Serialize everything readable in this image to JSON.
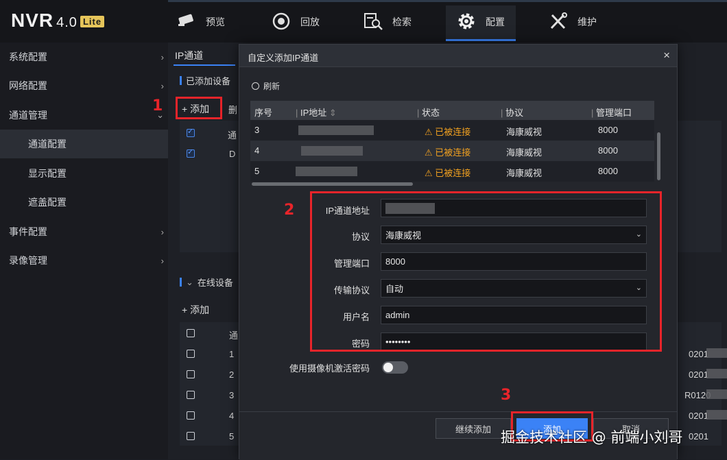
{
  "app": {
    "brand": "NVR",
    "version": "4.0",
    "edition": "Lite"
  },
  "nav": [
    {
      "label": "预览",
      "icon": "camera-icon"
    },
    {
      "label": "回放",
      "icon": "playback-icon"
    },
    {
      "label": "检索",
      "icon": "search-file-icon"
    },
    {
      "label": "配置",
      "icon": "gear-icon",
      "active": true
    },
    {
      "label": "维护",
      "icon": "tools-icon"
    }
  ],
  "sidebar": {
    "items": [
      {
        "label": "系统配置",
        "chevron": "›"
      },
      {
        "label": "网络配置",
        "chevron": "›"
      },
      {
        "label": "通道管理",
        "chevron": "⌄"
      },
      {
        "label": "通道配置"
      },
      {
        "label": "显示配置"
      },
      {
        "label": "遮盖配置"
      },
      {
        "label": "事件配置",
        "chevron": "›"
      },
      {
        "label": "录像管理",
        "chevron": "›"
      }
    ]
  },
  "main": {
    "tab": "IP通道",
    "added_section": "已添加设备",
    "add_label": "+ 添加",
    "del_label": "删",
    "added_rows": [
      {
        "col": "通"
      },
      {
        "col": "D"
      }
    ],
    "online_section": "在线设备",
    "online_add": "+ 添加",
    "online_header": "通",
    "online_rows": [
      {
        "no": "1",
        "serial": "0201"
      },
      {
        "no": "2",
        "serial": "0201"
      },
      {
        "no": "3",
        "serial": "R0120"
      },
      {
        "no": "4",
        "serial": "0201"
      },
      {
        "no": "5",
        "serial": "0201"
      }
    ]
  },
  "annotations": {
    "n1": "1",
    "n2": "2",
    "n3": "3"
  },
  "modal": {
    "title": "自定义添加IP通道",
    "close": "×",
    "refresh": "刷新",
    "columns": [
      "序号",
      "IP地址",
      "状态",
      "协议",
      "管理端口"
    ],
    "rows": [
      {
        "no": "3",
        "status": "已被连接",
        "protocol": "海康威视",
        "port": "8000"
      },
      {
        "no": "4",
        "status": "已被连接",
        "protocol": "海康威视",
        "port": "8000"
      },
      {
        "no": "5",
        "status": "已被连接",
        "protocol": "海康威视",
        "port": "8000"
      }
    ],
    "form": {
      "ip_label": "IP通道地址",
      "ip_value": "",
      "protocol_label": "协议",
      "protocol_value": "海康威视",
      "port_label": "管理端口",
      "port_value": "8000",
      "transport_label": "传输协议",
      "transport_value": "自动",
      "user_label": "用户名",
      "user_value": "admin",
      "pwd_label": "密码",
      "pwd_value": "••••••••",
      "activate_label": "使用摄像机激活密码"
    },
    "buttons": {
      "continue": "继续添加",
      "add": "添加",
      "cancel": "取消"
    }
  },
  "watermark": "掘金技术社区 @ 前端小刘哥"
}
